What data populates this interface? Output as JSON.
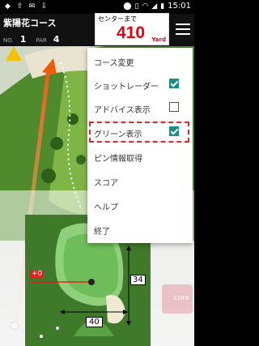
{
  "status_bar": {
    "time": "15:01",
    "icons": [
      "bell-icon",
      "upload-icon",
      "mail-icon",
      "download-icon",
      "location-icon",
      "vibrate-icon",
      "wifi-icon",
      "signal-icon",
      "battery-icon"
    ]
  },
  "header": {
    "course_name": "紫陽花コース",
    "hole_label": "NO.",
    "hole_number": "1",
    "par_label": "PAR",
    "par_value": "4",
    "distance_label": "センターまで",
    "distance_value": "410",
    "distance_unit": "Yard"
  },
  "menu": {
    "items": [
      {
        "label": "コース変更",
        "checkbox": null
      },
      {
        "label": "ショットレーダー",
        "checkbox": true
      },
      {
        "label": "アドバイス表示",
        "checkbox": false
      },
      {
        "label": "グリーン表示",
        "checkbox": true
      },
      {
        "label": "ピン情報取得",
        "checkbox": null
      },
      {
        "label": "スコア",
        "checkbox": null
      },
      {
        "label": "ヘルプ",
        "checkbox": null
      },
      {
        "label": "終了",
        "checkbox": null
      }
    ]
  },
  "green_view": {
    "offset_label": "+0",
    "depth_yards": "34",
    "width_yards": "40"
  },
  "score_button_label": "core",
  "colors": {
    "accent_red": "#e60012",
    "check_teal": "#1a8f86",
    "highlight_red": "#e0262b"
  }
}
